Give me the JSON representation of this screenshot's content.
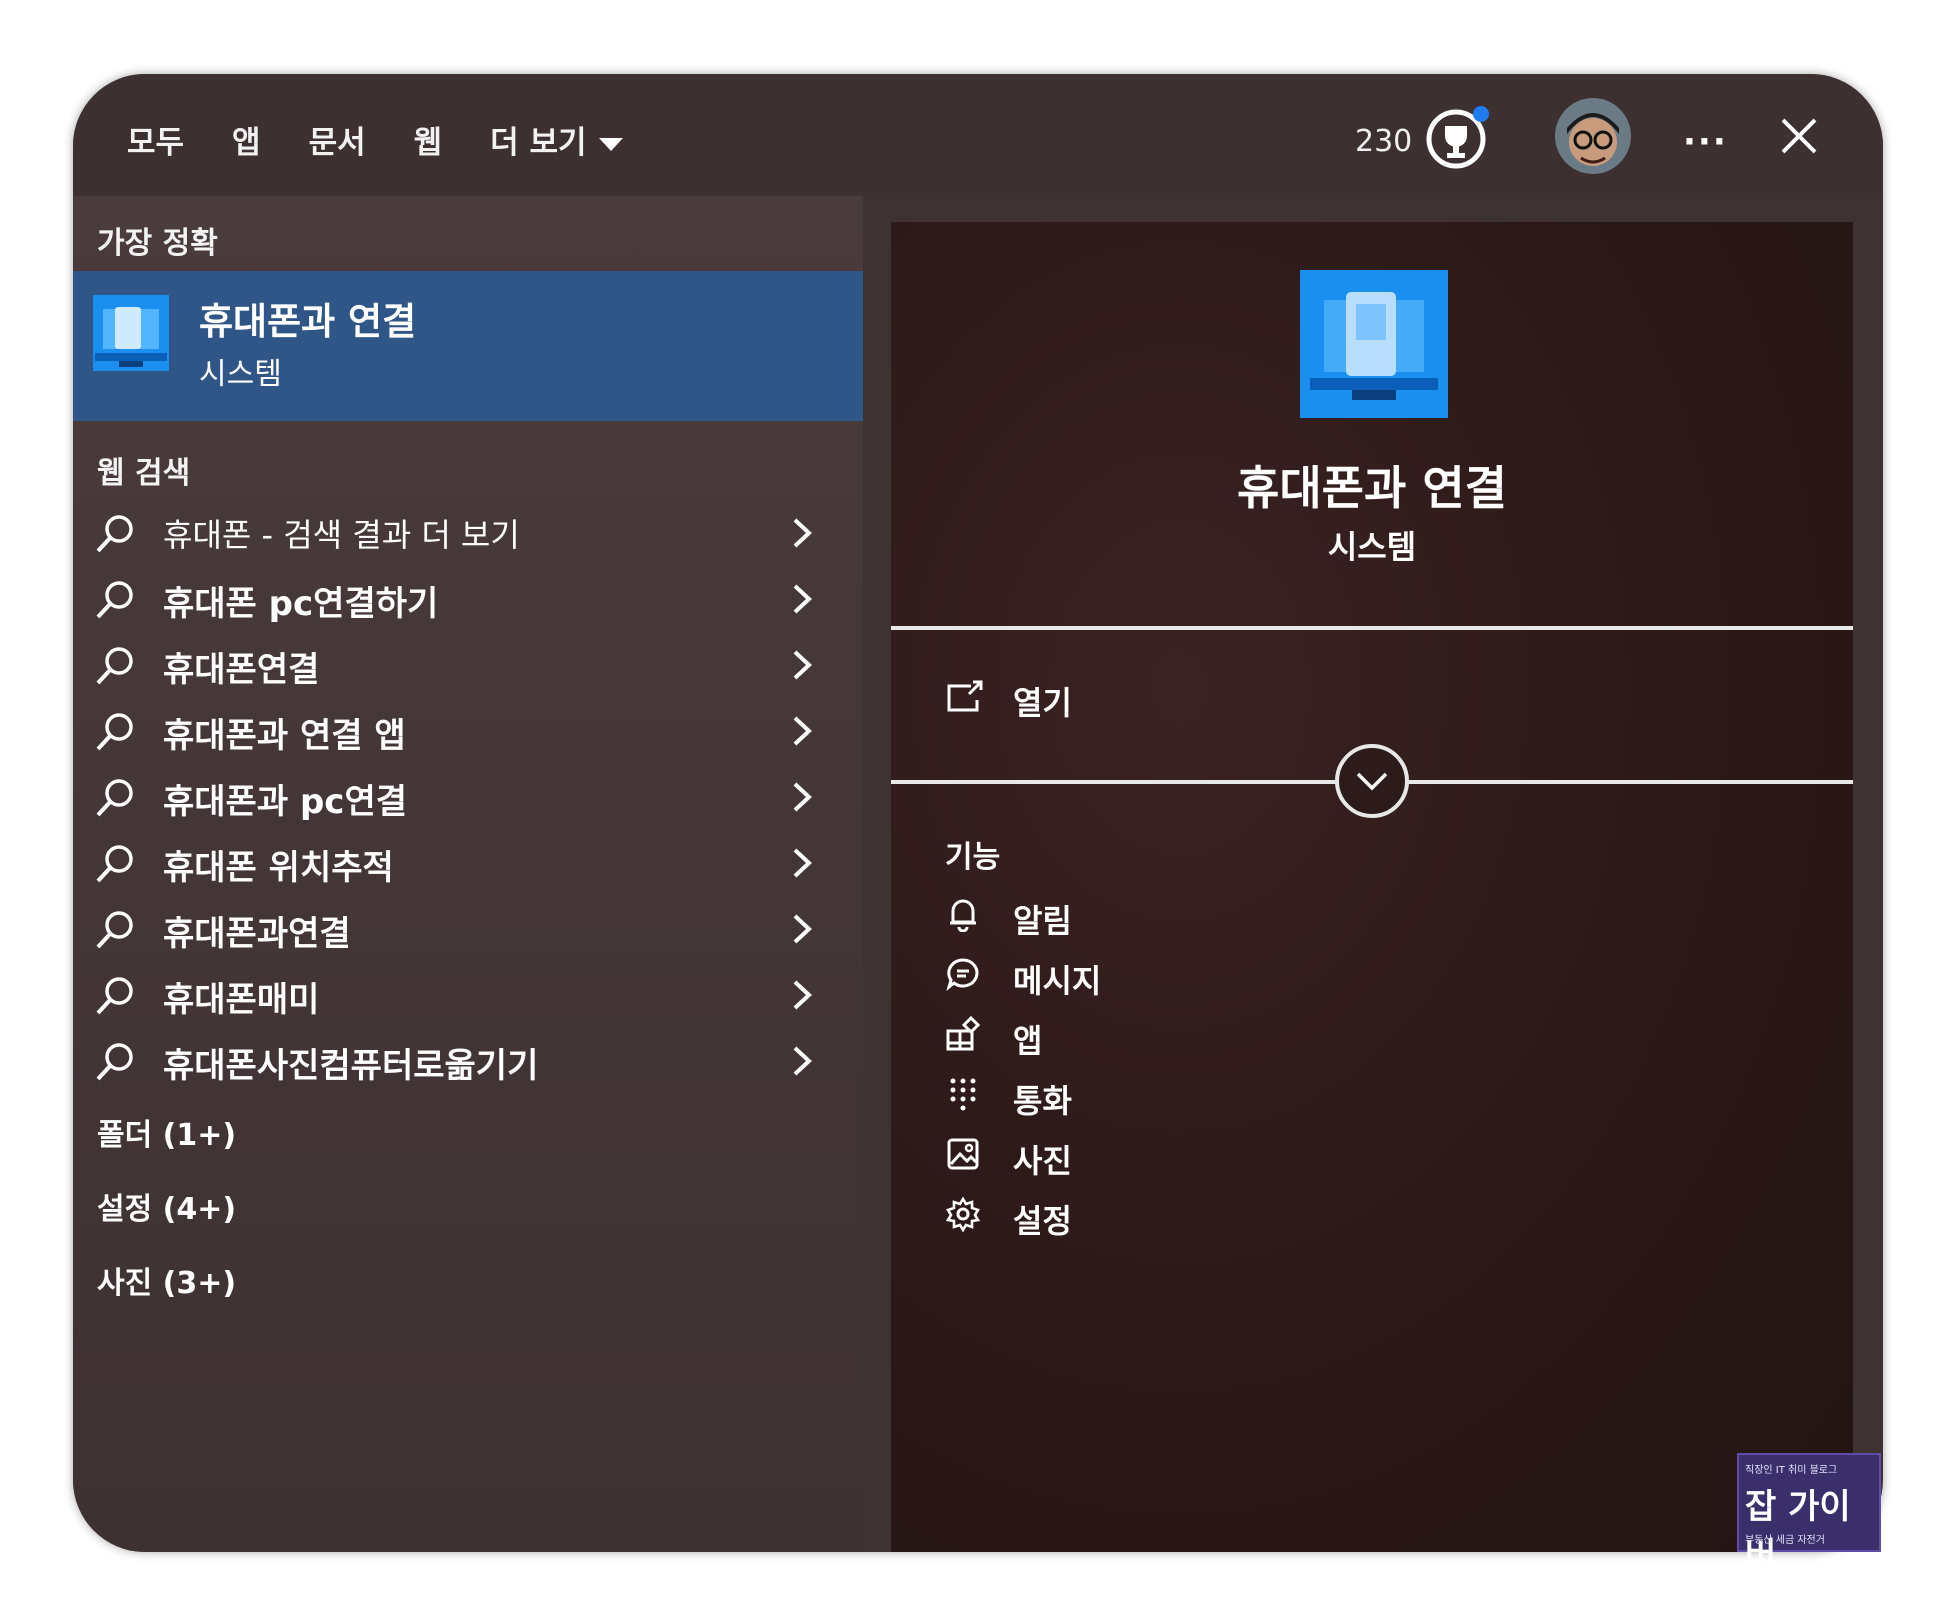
{
  "tabs": [
    {
      "label": "모두",
      "active": true
    },
    {
      "label": "앱"
    },
    {
      "label": "문서"
    },
    {
      "label": "웹"
    },
    {
      "label": "더 보기"
    }
  ],
  "points": "230",
  "best_match": {
    "heading": "가장 정확",
    "title": "휴대폰과 연결",
    "subtitle": "시스템"
  },
  "web_search": {
    "heading": "웹 검색",
    "items": [
      "휴대폰 - 검색 결과 더 보기",
      "휴대폰 pc연결하기",
      "휴대폰연결",
      "휴대폰과 연결 앱",
      "휴대폰과 pc연결",
      "휴대폰 위치추적",
      "휴대폰과연결",
      "휴대폰매미",
      "휴대폰사진컴퓨터로옮기기"
    ]
  },
  "categories": [
    "폴더 (1+)",
    "설정 (4+)",
    "사진 (3+)"
  ],
  "preview": {
    "title": "휴대폰과 연결",
    "subtitle": "시스템",
    "open_label": "열기",
    "features_heading": "기능",
    "features": [
      {
        "label": "알림",
        "icon": "bell-icon"
      },
      {
        "label": "메시지",
        "icon": "chat-icon"
      },
      {
        "label": "앱",
        "icon": "apps-icon"
      },
      {
        "label": "통화",
        "icon": "dialpad-icon"
      },
      {
        "label": "사진",
        "icon": "photo-icon"
      },
      {
        "label": "설정",
        "icon": "gear-icon"
      }
    ]
  },
  "watermark": {
    "top": "직장인 IT 취미 블로그",
    "main": "잡 가이버",
    "bottom": "부동산 세금 자전거"
  },
  "colors": {
    "accent": "#2d8ff0",
    "selected_row": "#2f5687",
    "pane_bg": "#3f3233",
    "preview_bg": "#2a1717"
  }
}
